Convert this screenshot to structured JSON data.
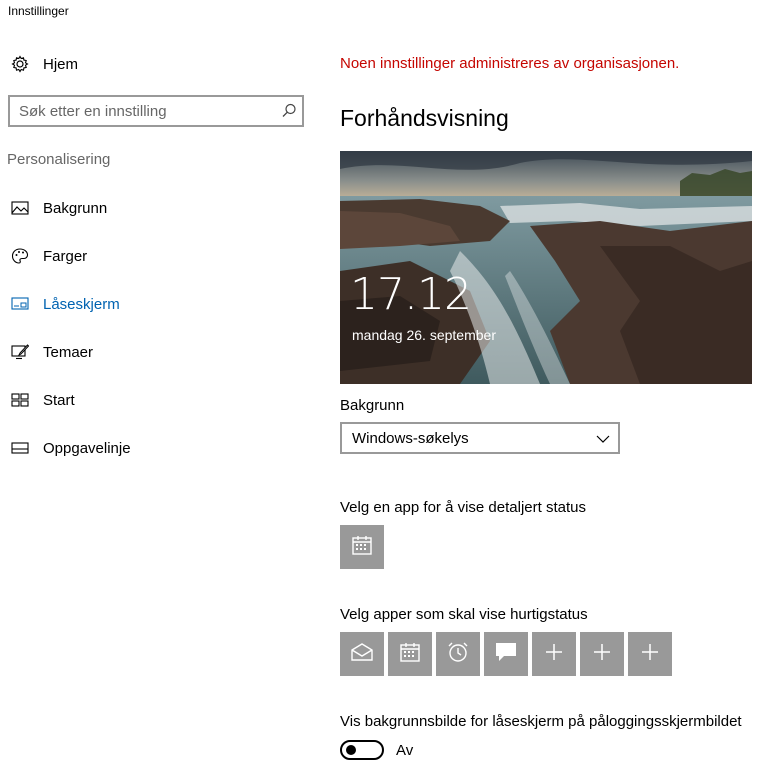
{
  "window": {
    "title": "Innstillinger"
  },
  "sidebar": {
    "home_label": "Hjem",
    "search_placeholder": "Søk etter en innstilling",
    "section_label": "Personalisering",
    "items": [
      {
        "label": "Bakgrunn",
        "icon": "picture-icon"
      },
      {
        "label": "Farger",
        "icon": "palette-icon"
      },
      {
        "label": "Låseskjerm",
        "icon": "lockscreen-icon",
        "active": true
      },
      {
        "label": "Temaer",
        "icon": "themes-icon"
      },
      {
        "label": "Start",
        "icon": "start-icon"
      },
      {
        "label": "Oppgavelinje",
        "icon": "taskbar-icon"
      }
    ]
  },
  "main": {
    "org_notice": "Noen innstillinger administreres av organisasjonen.",
    "preview_heading": "Forhåndsvisning",
    "preview": {
      "time": "17.12",
      "date": "mandag 26. september"
    },
    "background_label": "Bakgrunn",
    "background_value": "Windows-søkelys",
    "detailed_status_label": "Velg en app for å vise detaljert status",
    "quick_status_label": "Velg apper som skal vise hurtigstatus",
    "quick_status_apps": [
      "mail-icon",
      "calendar-icon",
      "alarm-icon",
      "message-icon",
      "plus-icon",
      "plus-icon",
      "plus-icon"
    ],
    "signin_bg_label": "Vis bakgrunnsbilde for låseskjerm på påloggingsskjermbildet",
    "signin_bg_state": "Av",
    "signin_bg_on": false
  },
  "colors": {
    "accent": "#0063b1",
    "warning": "#c50500",
    "tile": "#999999"
  }
}
